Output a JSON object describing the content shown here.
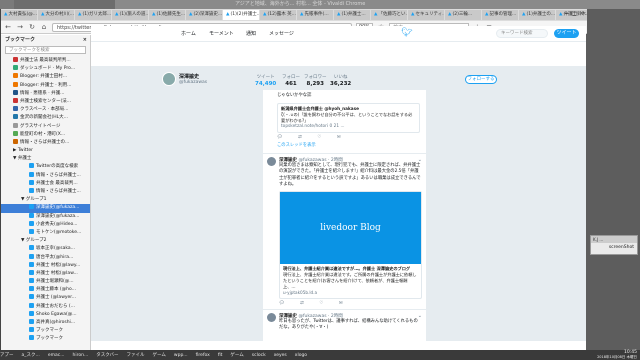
{
  "os": {
    "bg_window_title": "アジアと地域、海外から... 村松... 全体 - Vivaldi Chrome",
    "taskbar_items": [
      "アプー",
      "a_スク...",
      "emac...",
      "hiron...",
      "タスクバー",
      "ファイル",
      "ゲーム",
      "wpp...",
      "firefox",
      "fit",
      "ゲーム",
      "sclock",
      "xeyes",
      "xlogo"
    ],
    "clock_time": "10:45",
    "clock_date": "2018年10月08日 木曜日"
  },
  "browser": {
    "tabs": [
      "大村貴弘(@...",
      "大分の村川(...",
      "(1)ガリ太郎...",
      "(1)/旅人の道...",
      "(1)佐藤先生...",
      "(2)深澤諭史...",
      "(1)(2)弁護士...",
      "(12)露木 英...",
      "先帳事件(…",
      "(1)弁護士...",
      "「佐藤巧とい...",
      "セキュリティ...",
      "(2)三輪...",
      "記事の管理...",
      "(1)弁護士の...",
      "弁護士鈴木...",
      "(2)弁護士...",
      "「空間」の..."
    ],
    "active_tab_index": 6,
    "url": "https://twitter.com/fukazawashi/with_replies",
    "zoom": "90%",
    "search_placeholder": "検索",
    "window_controls": "− □ ×"
  },
  "sidebar": {
    "title": "ブックマーク",
    "close": "×",
    "search_placeholder": "ブックマークを検索",
    "items": [
      {
        "label": "弁護士法 最高裁判所判...",
        "color": "#c33"
      },
      {
        "label": "ダッシュボード · My Pro...",
        "color": "#3a7"
      },
      {
        "label": "Blogger: 弁護士田村...",
        "color": "#e70"
      },
      {
        "label": "Blogger: 弁護士 · 利用...",
        "color": "#e70"
      },
      {
        "label": "情報 · 悪徳系 · 弁護...",
        "color": "#258"
      },
      {
        "label": "弁護士検索センター(法...",
        "color": "#c33"
      },
      {
        "label": "クラスペース · 本部局...",
        "color": "#36a"
      },
      {
        "label": "金沢の新聞会社(HL大...",
        "color": "#27a"
      },
      {
        "label": "グラスサイトページ",
        "color": "#999"
      },
      {
        "label": "能登町の村・港町(X...",
        "color": "#5a5"
      },
      {
        "label": "情報・さらば弁護士の...",
        "color": "#c60"
      },
      {
        "label": "▶ Twitter",
        "color": "#888"
      },
      {
        "label": "▼ 弁護士",
        "color": "#888"
      },
      {
        "label": "Twitterの高度な検索",
        "color": "#1da1f2"
      },
      {
        "label": "情報・さらば弁護士...",
        "color": "#1da1f2"
      },
      {
        "label": "弁護士会 最高裁判...",
        "color": "#1da1f2"
      },
      {
        "label": "情報・さらば弁護士...",
        "color": "#1da1f2"
      },
      {
        "label": "▼ グループ1",
        "color": "#888"
      },
      {
        "label": "深澤諭史(@fukaza...",
        "color": "#1da1f2"
      },
      {
        "label": "深澤諭史(@fukaza...",
        "color": "#1da1f2"
      },
      {
        "label": "小倉秀夫(@Hideo...",
        "color": "#1da1f2"
      },
      {
        "label": "モトケン(@motoke...",
        "color": "#1da1f2"
      },
      {
        "label": "▼ グループ2",
        "color": "#888"
      },
      {
        "label": "坂本正幸(@saka...",
        "color": "#1da1f2"
      },
      {
        "label": "唐台平太(@hira...",
        "color": "#1da1f2"
      },
      {
        "label": "弁護士 村松(@lawy...",
        "color": "#1da1f2"
      },
      {
        "label": "弁護士 村松(@law...",
        "color": "#1da1f2"
      },
      {
        "label": "弁護士堀瀬和(@...",
        "color": "#1da1f2"
      },
      {
        "label": "弁護士藤本 (@ho...",
        "color": "#1da1f2"
      },
      {
        "label": "弁護士 (@lawyer...",
        "color": "#1da1f2"
      },
      {
        "label": "弁護士おだむら (...",
        "color": "#1da1f2"
      },
      {
        "label": "Shoko Egawa(@...",
        "color": "#1da1f2"
      },
      {
        "label": "高井真(@hiroshi...",
        "color": "#1da1f2"
      },
      {
        "label": "ブックマーク",
        "color": "#1da1f2"
      },
      {
        "label": "ブックマーク",
        "color": "#1da1f2"
      }
    ],
    "selected_index": 18
  },
  "twitter": {
    "nav": [
      "ホーム",
      "モーメント",
      "通知",
      "メッセージ"
    ],
    "search_placeholder": "キーワード検索",
    "tweet_button": "ツイート",
    "profile": {
      "name": "深澤諭史",
      "handle": "@fukazawas"
    },
    "stats": [
      {
        "label": "ツイート",
        "value": "74,490"
      },
      {
        "label": "フォロー",
        "value": "461"
      },
      {
        "label": "フォロワー",
        "value": "8,293"
      },
      {
        "label": "いいね",
        "value": "36,232"
      }
    ],
    "follow_button": "フォローする",
    "feed": {
      "partial_text": "じゃないかやな誌",
      "quoted_card": {
        "title": "新潟県弁護士会弁護士 @hyoh_nakase",
        "body": "ζ(・.∪の)「誰を飼わせ自分の不公平は、ということでなお話をする必要がわかる?」",
        "link": "topsketzal.note/hotori 0 21 ..."
      },
      "show_thread": "このスレッドを表示",
      "tweet1": {
        "name": "深澤諭史",
        "handle": "@fukazawas · 2時間",
        "text": "同業の皆さまは察知として、現行犯でも、弁護士に限定されば、弁弁護士の演説ができた。「弁護士を紹介します!」紹介料は最大金の2.5倍「弁護士が犯罪者に紹介をするという訳ですよ」あるいは職業は成立できるんですよね。",
        "card_image": "livedoor Blog",
        "card_title": "現行法上、弁護士紹介業は違法ですが…。弁護士 深澤諭史のブログ",
        "card_body": "現行法上、弁護士紹介業は違法です。ご所属の弁護士が弁護士に依頼したということを紹介(お客さんを紹介)けて、依頼者が、弁護士報酬上、…",
        "card_link": "u-yjptak05b.ld.a"
      },
      "tweet2": {
        "name": "深澤諭史",
        "handle": "@fukazawas · 2時間",
        "text": "昨日も思ったが、Twitterは、議事すれば、結構みんな助けてくれるものだな。ありがたや(・∀・)"
      }
    }
  },
  "popup": {
    "title": "K.J ...",
    "body": "screenShot"
  }
}
